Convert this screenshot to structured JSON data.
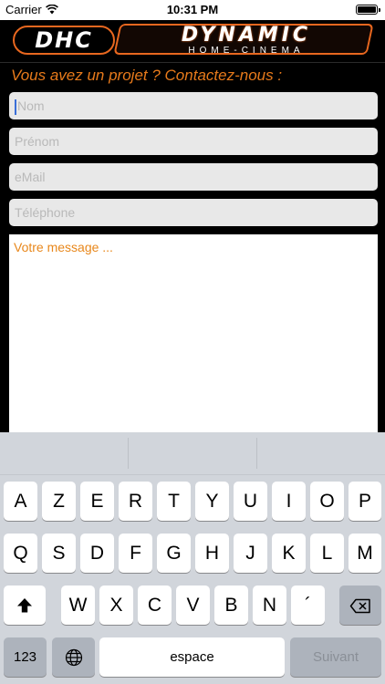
{
  "status_bar": {
    "carrier": "Carrier",
    "time": "10:31 PM",
    "icons": [
      "wifi-icon",
      "battery-icon"
    ]
  },
  "logo": {
    "monogram": "DHC",
    "brand_name": "DYNAMIC",
    "brand_sub": "HOME-CINEMA"
  },
  "form": {
    "heading": "Vous avez un projet ? Contactez-nous :",
    "name_placeholder": "Nom",
    "firstname_placeholder": "Prénom",
    "email_placeholder": "eMail",
    "phone_placeholder": "Téléphone",
    "message_placeholder": "Votre message ..."
  },
  "colors": {
    "accent": "#e77a1b",
    "field_bg": "#e8e8e8",
    "keyboard_bg": "#d1d5db"
  },
  "keyboard": {
    "row1": [
      "A",
      "Z",
      "E",
      "R",
      "T",
      "Y",
      "U",
      "I",
      "O",
      "P"
    ],
    "row2": [
      "Q",
      "S",
      "D",
      "F",
      "G",
      "H",
      "J",
      "K",
      "L",
      "M"
    ],
    "row3": [
      "W",
      "X",
      "C",
      "V",
      "B",
      "N",
      "´"
    ],
    "numbers_key": "123",
    "space_key": "espace",
    "next_key": "Suivant",
    "icons": [
      "shift-icon",
      "backspace-icon",
      "globe-icon"
    ]
  }
}
